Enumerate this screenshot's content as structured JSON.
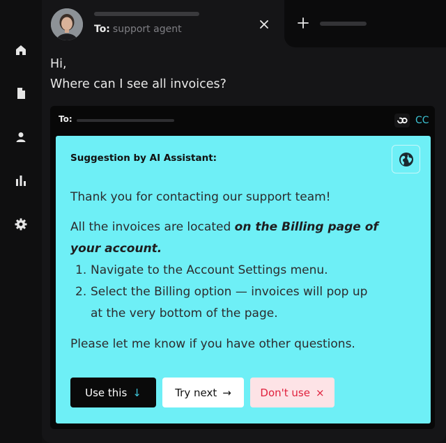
{
  "sidebar": {
    "items": [
      {
        "name": "home-icon"
      },
      {
        "name": "document-icon"
      },
      {
        "name": "user-icon"
      },
      {
        "name": "bar-chart-icon"
      },
      {
        "name": "gear-icon"
      }
    ]
  },
  "header": {
    "to_label": "To:",
    "to_value": "support agent"
  },
  "message": {
    "line1": "Hi,",
    "line2": "Where can I see all invoices?"
  },
  "reply": {
    "to_label": "To:",
    "cc_label": "CC"
  },
  "suggestion": {
    "title": "Suggestion by AI Assistant:",
    "greeting": "Thank you for contacting our support team!",
    "intro": "All the invoices are located",
    "intro_bold_1": "on the Billing page of",
    "intro_bold_2": "your account.",
    "steps": [
      {
        "num": "1.",
        "lines": [
          "Navigate to the Account Settings menu."
        ]
      },
      {
        "num": "2.",
        "lines": [
          "Select the Billing option — invoices will pop up",
          "at the very bottom of the page."
        ]
      }
    ],
    "closing": "Please let me know if you have other questions.",
    "buttons": {
      "use": "Use this",
      "use_icon": "↓",
      "next": "Try next",
      "next_icon": "→",
      "dont": "Don't use",
      "dont_icon": "×"
    }
  },
  "colors": {
    "accent": "#6eeff6",
    "cc": "#3cc2d2",
    "danger": "#e0203c",
    "background": "#111112"
  }
}
